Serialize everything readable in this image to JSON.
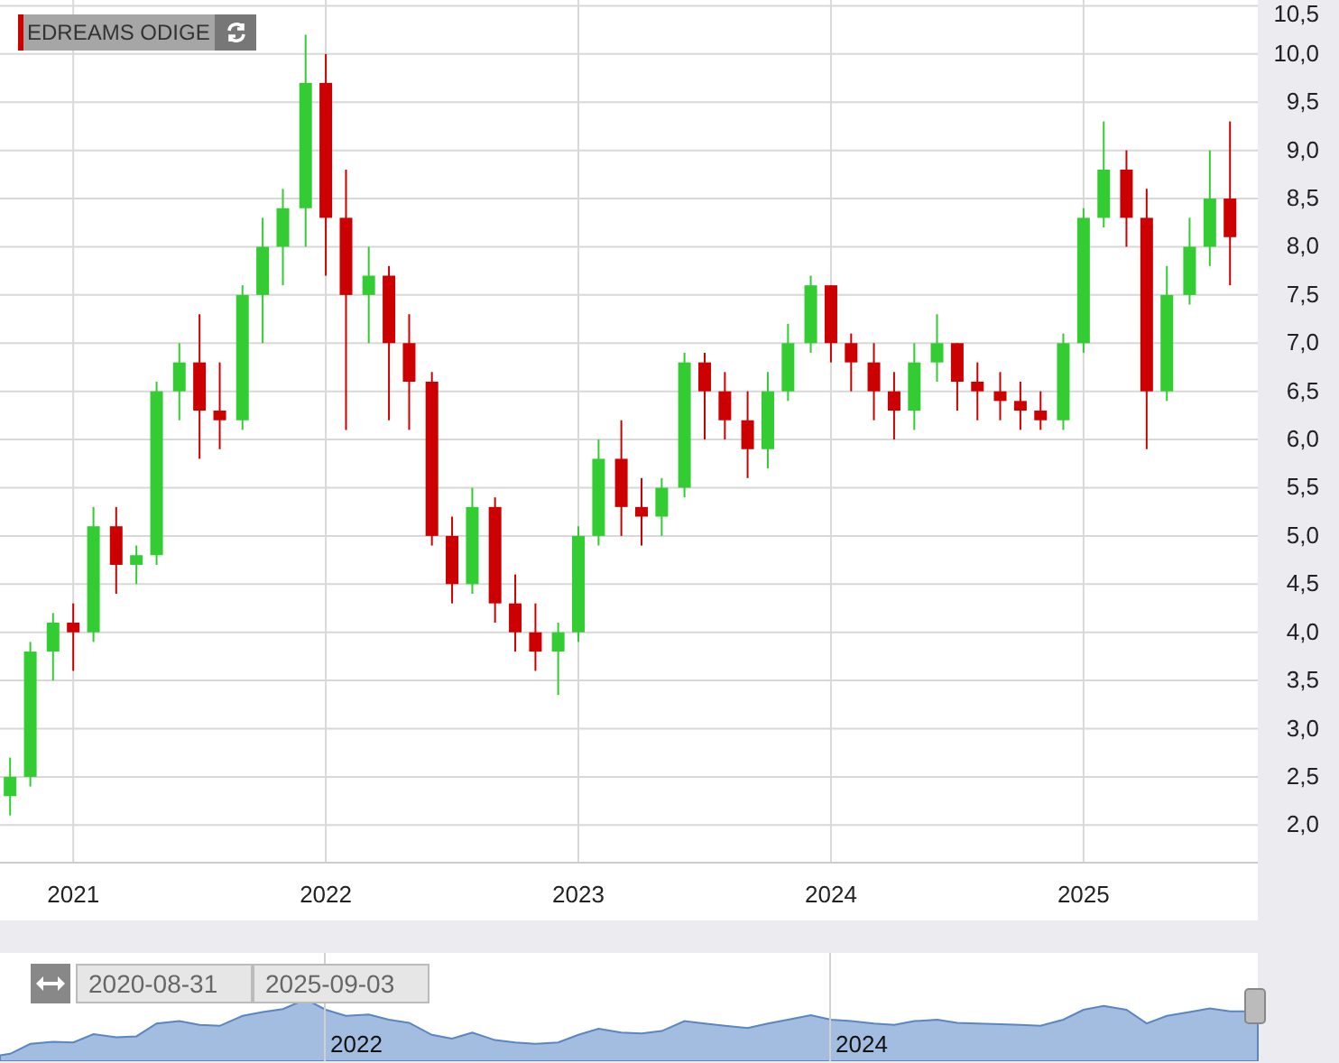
{
  "instrument_label": {
    "text": "EDREAMS ODIGE"
  },
  "chart_data": {
    "type": "candlestick",
    "x": [
      2020.75,
      2020.83,
      2020.92,
      2021.0,
      2021.08,
      2021.17,
      2021.25,
      2021.33,
      2021.42,
      2021.5,
      2021.58,
      2021.67,
      2021.75,
      2021.83,
      2021.92,
      2022.0,
      2022.08,
      2022.17,
      2022.25,
      2022.33,
      2022.42,
      2022.5,
      2022.58,
      2022.67,
      2022.75,
      2022.83,
      2022.92,
      2023.0,
      2023.08,
      2023.17,
      2023.25,
      2023.33,
      2023.42,
      2023.5,
      2023.58,
      2023.67,
      2023.75,
      2023.83,
      2023.92,
      2024.0,
      2024.08,
      2024.17,
      2024.25,
      2024.33,
      2024.42,
      2024.5,
      2024.58,
      2024.67,
      2024.75,
      2024.83,
      2024.92,
      2025.0,
      2025.08,
      2025.17,
      2025.25,
      2025.33,
      2025.42,
      2025.5,
      2025.58
    ],
    "ohlc": [
      [
        2.3,
        2.7,
        2.1,
        2.5
      ],
      [
        2.5,
        3.9,
        2.4,
        3.8
      ],
      [
        3.8,
        4.2,
        3.5,
        4.1
      ],
      [
        4.1,
        4.3,
        3.6,
        4.0
      ],
      [
        4.0,
        5.3,
        3.9,
        5.1
      ],
      [
        5.1,
        5.3,
        4.4,
        4.7
      ],
      [
        4.7,
        4.9,
        4.5,
        4.8
      ],
      [
        4.8,
        6.6,
        4.7,
        6.5
      ],
      [
        6.5,
        7.0,
        6.2,
        6.8
      ],
      [
        6.8,
        7.3,
        5.8,
        6.3
      ],
      [
        6.3,
        6.8,
        5.9,
        6.2
      ],
      [
        6.2,
        7.6,
        6.1,
        7.5
      ],
      [
        7.5,
        8.3,
        7.0,
        8.0
      ],
      [
        8.0,
        8.6,
        7.6,
        8.4
      ],
      [
        8.4,
        10.2,
        8.0,
        9.7
      ],
      [
        9.7,
        10.0,
        7.7,
        8.3
      ],
      [
        8.3,
        8.8,
        6.1,
        7.5
      ],
      [
        7.5,
        8.0,
        7.0,
        7.7
      ],
      [
        7.7,
        7.8,
        6.2,
        7.0
      ],
      [
        7.0,
        7.3,
        6.1,
        6.6
      ],
      [
        6.6,
        6.7,
        4.9,
        5.0
      ],
      [
        5.0,
        5.2,
        4.3,
        4.5
      ],
      [
        4.5,
        5.5,
        4.4,
        5.3
      ],
      [
        5.3,
        5.4,
        4.1,
        4.3
      ],
      [
        4.3,
        4.6,
        3.8,
        4.0
      ],
      [
        4.0,
        4.3,
        3.6,
        3.8
      ],
      [
        3.8,
        4.1,
        3.35,
        4.0
      ],
      [
        4.0,
        5.1,
        3.9,
        5.0
      ],
      [
        5.0,
        6.0,
        4.9,
        5.8
      ],
      [
        5.8,
        6.2,
        5.0,
        5.3
      ],
      [
        5.3,
        5.6,
        4.9,
        5.2
      ],
      [
        5.2,
        5.6,
        5.0,
        5.5
      ],
      [
        5.5,
        6.9,
        5.4,
        6.8
      ],
      [
        6.8,
        6.9,
        6.0,
        6.5
      ],
      [
        6.5,
        6.7,
        6.0,
        6.2
      ],
      [
        6.2,
        6.5,
        5.6,
        5.9
      ],
      [
        5.9,
        6.7,
        5.7,
        6.5
      ],
      [
        6.5,
        7.2,
        6.4,
        7.0
      ],
      [
        7.0,
        7.7,
        6.9,
        7.6
      ],
      [
        7.6,
        7.6,
        6.8,
        7.0
      ],
      [
        7.0,
        7.1,
        6.5,
        6.8
      ],
      [
        6.8,
        7.0,
        6.2,
        6.5
      ],
      [
        6.5,
        6.7,
        6.0,
        6.3
      ],
      [
        6.3,
        7.0,
        6.1,
        6.8
      ],
      [
        6.8,
        7.3,
        6.6,
        7.0
      ],
      [
        7.0,
        7.0,
        6.3,
        6.6
      ],
      [
        6.6,
        6.8,
        6.2,
        6.5
      ],
      [
        6.5,
        6.7,
        6.2,
        6.4
      ],
      [
        6.4,
        6.6,
        6.1,
        6.3
      ],
      [
        6.3,
        6.5,
        6.1,
        6.2
      ],
      [
        6.2,
        7.1,
        6.1,
        7.0
      ],
      [
        7.0,
        8.4,
        6.9,
        8.3
      ],
      [
        8.3,
        9.3,
        8.2,
        8.8
      ],
      [
        8.8,
        9.0,
        8.0,
        8.3
      ],
      [
        8.3,
        8.6,
        5.9,
        6.5
      ],
      [
        6.5,
        7.8,
        6.4,
        7.5
      ],
      [
        7.5,
        8.3,
        7.4,
        8.0
      ],
      [
        8.0,
        9.0,
        7.8,
        8.5
      ],
      [
        8.5,
        9.3,
        7.6,
        8.1
      ]
    ],
    "grid": true,
    "xlim": [
      2020.71,
      2025.69
    ],
    "ylim": [
      1.61,
      10.56
    ],
    "yticks": [
      {
        "value": 10.5,
        "label": "10,5"
      },
      {
        "value": 10,
        "label": "10,0"
      },
      {
        "value": 9.5,
        "label": "9,5"
      },
      {
        "value": 9,
        "label": "9,0"
      },
      {
        "value": 8.5,
        "label": "8,5"
      },
      {
        "value": 8,
        "label": "8,0"
      },
      {
        "value": 7.5,
        "label": "7,5"
      },
      {
        "value": 7,
        "label": "7,0"
      },
      {
        "value": 6.5,
        "label": "6,5"
      },
      {
        "value": 6,
        "label": "6,0"
      },
      {
        "value": 5.5,
        "label": "5,5"
      },
      {
        "value": 5,
        "label": "5,0"
      },
      {
        "value": 4.5,
        "label": "4,5"
      },
      {
        "value": 4,
        "label": "4,0"
      },
      {
        "value": 3.5,
        "label": "3,5"
      },
      {
        "value": 3,
        "label": "3,0"
      },
      {
        "value": 2.5,
        "label": "2,5"
      },
      {
        "value": 2,
        "label": "2,0"
      }
    ],
    "xticks": [
      2021,
      2022,
      2023,
      2024,
      2025
    ]
  },
  "navigator": {
    "start_date": "2020-08-31",
    "end_date": "2025-09-03",
    "labels": [
      "2022",
      "2024"
    ]
  }
}
